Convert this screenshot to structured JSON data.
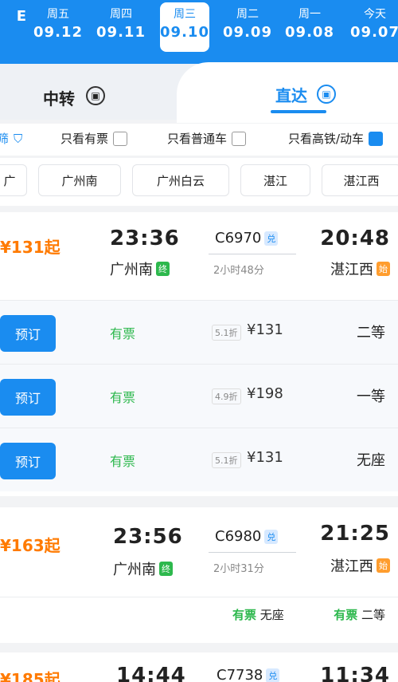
{
  "dates": [
    {
      "weekday": "今天",
      "date": "09.07"
    },
    {
      "weekday": "周一",
      "date": "09.08"
    },
    {
      "weekday": "周二",
      "date": "09.09"
    },
    {
      "weekday": "周三",
      "date": "09.10"
    },
    {
      "weekday": "周四",
      "date": "09.11"
    },
    {
      "weekday": "周五",
      "date": "09.12"
    },
    {
      "weekday": "",
      "date": "E"
    }
  ],
  "tabs": {
    "direct": "直达",
    "transfer": "中转"
  },
  "filters": {
    "high_speed": "只看高铁/动车",
    "normal": "只看普通车",
    "has_ticket": "只看有票",
    "filter_link": "筛"
  },
  "chips": [
    "湛江西",
    "湛江",
    "广州白云",
    "广州南",
    "广"
  ],
  "cards": [
    {
      "dep_time": "20:48",
      "dep_station": "湛江西",
      "dep_tag": "始",
      "train": "C6970",
      "train_tag": "兑",
      "duration": "2小时48分",
      "arr_time": "23:36",
      "arr_station": "广州南",
      "arr_tag": "终",
      "price": "¥131起",
      "seats": [
        {
          "name": "二等",
          "price": "¥131",
          "discount": "5.1折",
          "status": "有票",
          "button": "预订"
        },
        {
          "name": "一等",
          "price": "¥198",
          "discount": "4.9折",
          "status": "有票",
          "button": "预订"
        },
        {
          "name": "无座",
          "price": "¥131",
          "discount": "5.1折",
          "status": "有票",
          "button": "预订"
        }
      ]
    },
    {
      "dep_time": "21:25",
      "dep_station": "湛江西",
      "dep_tag": "始",
      "train": "C6980",
      "train_tag": "兑",
      "duration": "2小时31分",
      "arr_time": "23:56",
      "arr_station": "广州南",
      "arr_tag": "终",
      "price": "¥163起",
      "mini_seats": [
        {
          "name": "二等",
          "status": "有票"
        },
        {
          "name": "无座",
          "status": "有票"
        }
      ]
    },
    {
      "dep_time": "11:34",
      "train": "C7738",
      "train_tag": "兑",
      "arr_time": "14:44",
      "price": "¥185起"
    }
  ]
}
